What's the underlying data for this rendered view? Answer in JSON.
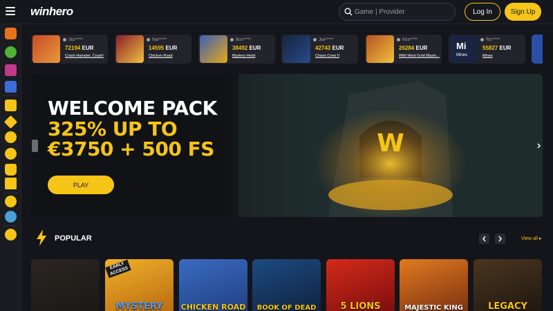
{
  "header": {
    "logo": "winhero",
    "search_placeholder": "Game | Provider",
    "login_label": "Log In",
    "signup_label": "Sign Up"
  },
  "sidebar": {
    "icons": [
      "carrot-icon",
      "ball-icon",
      "gift-icon",
      "hat-icon",
      "dice-icon",
      "diamond-icon",
      "tennis-icon",
      "football-icon",
      "trophy-icon",
      "crown-icon",
      "chat-icon",
      "globe-icon",
      "download-icon"
    ]
  },
  "ticker": [
    {
      "user": "Sta*****",
      "amount": "72194",
      "currency": "EUR",
      "game": "Crash Hamster, Crash!",
      "color": "#c84a2a"
    },
    {
      "user": "Nat*****",
      "amount": "14595",
      "currency": "EUR",
      "game": "Chicken Road",
      "color": "#8c1e2a"
    },
    {
      "user": "Bos*****",
      "amount": "38492",
      "currency": "EUR",
      "game": "Mystery Heist",
      "color": "#3b5fb8"
    },
    {
      "user": "Jue*****",
      "amount": "42743",
      "currency": "EUR",
      "game": "Chaos Crew II",
      "color": "#16243f"
    },
    {
      "user": "Kha*****",
      "amount": "26284",
      "currency": "EUR",
      "game": "Wild West Gold Blazin...",
      "color": "#b8541e"
    },
    {
      "user": "Ric*****",
      "amount": "55827",
      "currency": "EUR",
      "game": "Mines",
      "thumb_text": "Mi",
      "thumb_sub": "Mines",
      "color": "#1a2440"
    }
  ],
  "hero": {
    "line1": "WELCOME PACK",
    "line2": "325% UP TO",
    "line3": "€3750 + 500 FS",
    "play_label": "PLAY",
    "badge_letter": "W"
  },
  "popular": {
    "title": "POPULAR",
    "view_all": "View all",
    "games": [
      {
        "title": "",
        "color": "#231f1c"
      },
      {
        "title": "MYSTERY",
        "badge": "EARLY ACCESS",
        "color": "#e59a18"
      },
      {
        "title": "CHICKEN ROAD",
        "color": "#2f5fa8"
      },
      {
        "title": "BOOK OF DEAD",
        "color": "#1a3c6a"
      },
      {
        "title": "5 LIONS",
        "color": "#b81a1a"
      },
      {
        "title": "MAJESTIC KING",
        "color": "#c4541a"
      },
      {
        "title": "LEGACY",
        "color": "#3a2a16"
      }
    ]
  },
  "colors": {
    "accent": "#f5c518",
    "bg": "#14151b"
  }
}
